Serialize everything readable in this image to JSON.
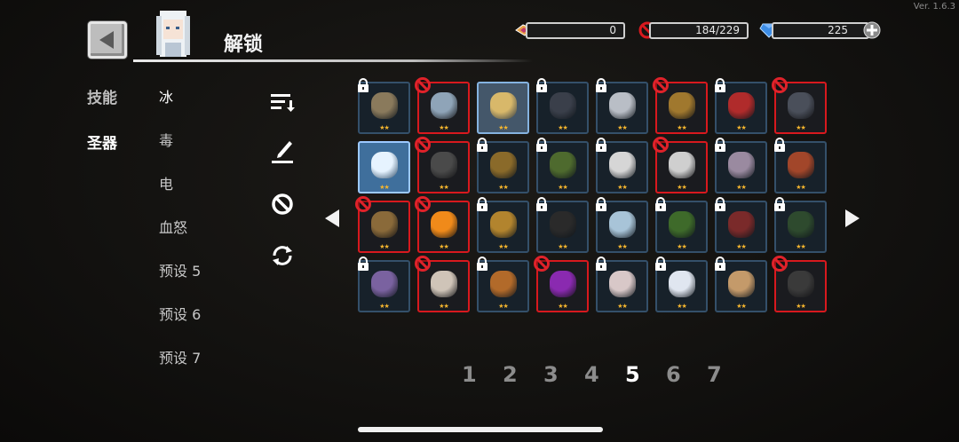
{
  "version": "Ver. 1.6.3",
  "header": {
    "title": "解锁",
    "back_icon": "back-arrow-icon",
    "avatar_icon": "character-portrait-icon"
  },
  "resources": [
    {
      "icon": "gem-shard-icon",
      "value": "0"
    },
    {
      "icon": "ban-icon",
      "value": "184/229"
    },
    {
      "icon": "diamond-icon",
      "value": "225",
      "extra_icon": "add-icon"
    }
  ],
  "categories": [
    {
      "label": "技能",
      "active": false
    },
    {
      "label": "圣器",
      "active": true
    }
  ],
  "subcategories": [
    "冰",
    "毒",
    "电",
    "血怒",
    "预设 5",
    "预设 6",
    "预设 7"
  ],
  "tools": [
    "sort-icon",
    "brush-icon",
    "ban-filter-icon",
    "refresh-icon"
  ],
  "pagination": {
    "pages": [
      "1",
      "2",
      "3",
      "4",
      "5",
      "6",
      "7"
    ],
    "current": "5"
  },
  "colors": {
    "banned_border": "#d8191e",
    "normal_border": "#34506a",
    "selected_bg": "#3f6f9c",
    "star": "#f4b52e"
  },
  "items": [
    {
      "name": "skull-item-icon",
      "status": "locked",
      "stars": 2,
      "color": "#8a7a5c"
    },
    {
      "name": "crystal-rock-item-icon",
      "status": "banned",
      "stars": 2,
      "color": "#8fa4b8"
    },
    {
      "name": "egg-nest-item-icon",
      "status": "highlight",
      "stars": 2,
      "color": "#d8b86a"
    },
    {
      "name": "dark-ufo-item-icon",
      "status": "locked",
      "stars": 2,
      "color": "#3a3f4a"
    },
    {
      "name": "crescent-item-icon",
      "status": "locked",
      "stars": 2,
      "color": "#b9bec6"
    },
    {
      "name": "cloak-item-icon",
      "status": "banned",
      "stars": 2,
      "color": "#a0782e"
    },
    {
      "name": "cape-item-icon",
      "status": "locked",
      "stars": 2,
      "color": "#b02b2b"
    },
    {
      "name": "gauntlet-item-icon",
      "status": "banned",
      "stars": 2,
      "color": "#4a4f5a"
    },
    {
      "name": "ice-apple-item-icon",
      "status": "selected",
      "stars": 2,
      "color": "#e6f3ff"
    },
    {
      "name": "stone-coin-item-icon",
      "status": "banned",
      "stars": 2,
      "color": "#4a4a4a"
    },
    {
      "name": "medal-item-icon",
      "status": "locked",
      "stars": 2,
      "color": "#8a6a2a"
    },
    {
      "name": "leaf-item-icon",
      "status": "locked",
      "stars": 2,
      "color": "#4e6a2e"
    },
    {
      "name": "flower-item-icon",
      "status": "locked",
      "stars": 2,
      "color": "#d6d6d6"
    },
    {
      "name": "lightning-item-icon",
      "status": "banned",
      "stars": 2,
      "color": "#cfcfcf"
    },
    {
      "name": "crystal-cluster-item-icon",
      "status": "locked",
      "stars": 2,
      "color": "#9a8aa0"
    },
    {
      "name": "lantern-item-icon",
      "status": "locked",
      "stars": 2,
      "color": "#a2462a"
    },
    {
      "name": "peace-amulet-item-icon",
      "status": "banned",
      "stars": 2,
      "color": "#8a6a3a"
    },
    {
      "name": "orange-item-icon",
      "status": "banned",
      "stars": 2,
      "color": "#f08a1a"
    },
    {
      "name": "planet-item-icon",
      "status": "locked",
      "stars": 2,
      "color": "#b2842e"
    },
    {
      "name": "dark-stone-item-icon",
      "status": "locked",
      "stars": 2,
      "color": "#2a2a2a"
    },
    {
      "name": "ice-shard-item-icon",
      "status": "locked",
      "stars": 2,
      "color": "#a8c4d8"
    },
    {
      "name": "green-fruit-item-icon",
      "status": "locked",
      "stars": 2,
      "color": "#3e6a2a"
    },
    {
      "name": "red-egg-item-icon",
      "status": "locked",
      "stars": 2,
      "color": "#7a2a2a"
    },
    {
      "name": "feather-item-icon",
      "status": "locked",
      "stars": 2,
      "color": "#2e4a2e"
    },
    {
      "name": "amethyst-item-icon",
      "status": "locked",
      "stars": 2,
      "color": "#7a62a0"
    },
    {
      "name": "envelope-item-icon",
      "status": "banned",
      "stars": 2,
      "color": "#cfc4b8"
    },
    {
      "name": "ring-item-icon",
      "status": "locked",
      "stars": 2,
      "color": "#b26a2a"
    },
    {
      "name": "dark-orb-item-icon",
      "status": "banned",
      "stars": 2,
      "color": "#8a2ab0"
    },
    {
      "name": "shell-pearl-item-icon",
      "status": "locked",
      "stars": 2,
      "color": "#d8c8c8"
    },
    {
      "name": "snowflake-item-icon",
      "status": "locked",
      "stars": 2,
      "color": "#e0e6f0"
    },
    {
      "name": "wand-item-icon",
      "status": "locked",
      "stars": 2,
      "color": "#c49a6a"
    },
    {
      "name": "necklace-item-icon",
      "status": "banned",
      "stars": 2,
      "color": "#3a3a3a"
    }
  ]
}
